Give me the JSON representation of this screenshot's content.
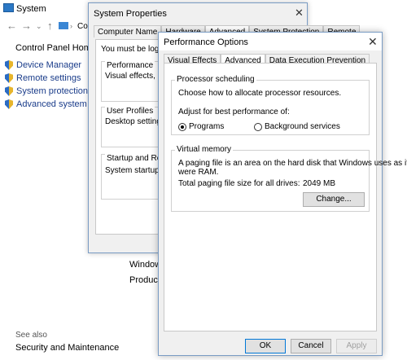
{
  "system_window": {
    "title": "System",
    "address": "Co",
    "control_panel_home": "Control Panel Home",
    "sidebar_items": [
      {
        "label": "Device Manager"
      },
      {
        "label": "Remote settings"
      },
      {
        "label": "System protection"
      },
      {
        "label": "Advanced system settings"
      }
    ],
    "background_labels": {
      "windows": "Windows a",
      "product_id": "Product ID"
    },
    "see_also": "See also",
    "security_maintenance": "Security and Maintenance"
  },
  "system_properties": {
    "title": "System Properties",
    "close": "✕",
    "tabs": [
      {
        "label": "Computer Name"
      },
      {
        "label": "Hardware"
      },
      {
        "label": "Advanced"
      },
      {
        "label": "System Protection"
      },
      {
        "label": "Remote"
      }
    ],
    "logged_on": "You must be logged on",
    "groups": [
      {
        "label": "Performance",
        "text": "Visual effects, process"
      },
      {
        "label": "User Profiles",
        "text": "Desktop settings relat"
      },
      {
        "label": "Startup and Recovery",
        "text": "System startup, syster"
      }
    ]
  },
  "performance_options": {
    "title": "Performance Options",
    "close": "✕",
    "tabs": [
      {
        "label": "Visual Effects"
      },
      {
        "label": "Advanced"
      },
      {
        "label": "Data Execution Prevention"
      }
    ],
    "processor_scheduling": {
      "label": "Processor scheduling",
      "desc": "Choose how to allocate processor resources.",
      "adjust_label": "Adjust for best performance of:",
      "options": [
        {
          "label": "Programs",
          "selected": true
        },
        {
          "label": "Background services",
          "selected": false
        }
      ]
    },
    "virtual_memory": {
      "label": "Virtual memory",
      "desc_line1": "A paging file is an area on the hard disk that Windows uses as if it",
      "desc_line2": "were RAM.",
      "total_label": "Total paging file size for all drives:",
      "total_value": "2049 MB",
      "change_button": "Change..."
    },
    "buttons": {
      "ok": "OK",
      "cancel": "Cancel",
      "apply": "Apply"
    }
  }
}
